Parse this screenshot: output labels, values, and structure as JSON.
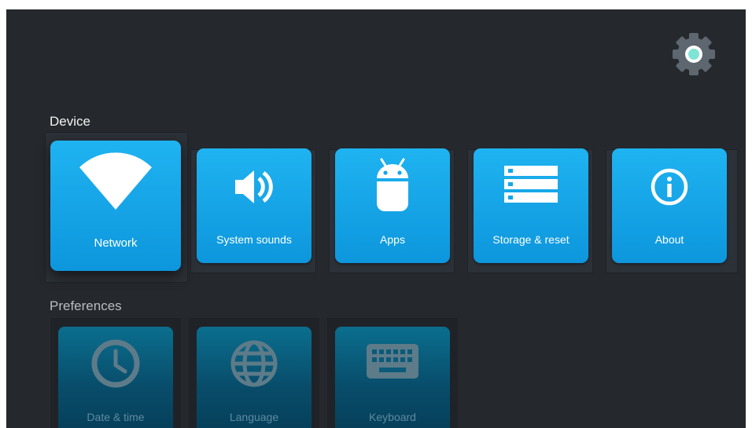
{
  "header": {
    "settings_icon": "gear-icon"
  },
  "sections": {
    "device": {
      "title": "Device",
      "items": [
        {
          "label": "Network",
          "icon": "wifi-icon",
          "focused": true
        },
        {
          "label": "System sounds",
          "icon": "speaker-icon"
        },
        {
          "label": "Apps",
          "icon": "android-icon"
        },
        {
          "label": "Storage & reset",
          "icon": "storage-icon"
        },
        {
          "label": "About",
          "icon": "info-icon"
        }
      ]
    },
    "preferences": {
      "title": "Preferences",
      "items": [
        {
          "label": "Date & time",
          "icon": "clock-icon"
        },
        {
          "label": "Language",
          "icon": "globe-icon"
        },
        {
          "label": "Keyboard",
          "icon": "keyboard-icon"
        }
      ]
    }
  },
  "colors": {
    "background": "#25292e",
    "tile_accent": "#14a6ea",
    "gear_accent": "#7fe3d6"
  }
}
